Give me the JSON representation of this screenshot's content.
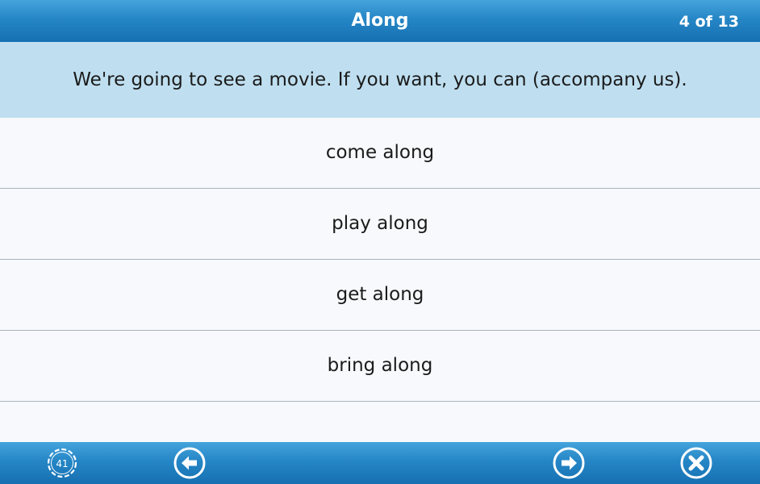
{
  "header": {
    "title": "Along",
    "counter": "4 of 13"
  },
  "question": {
    "text": "We're going to see a movie. If you want, you can (accompany us)."
  },
  "answers": [
    {
      "label": "come along"
    },
    {
      "label": "play along"
    },
    {
      "label": "get along"
    },
    {
      "label": "bring along"
    }
  ],
  "footer": {
    "timer_value": "41",
    "icons": [
      "timer-icon",
      "back-arrow-icon",
      "forward-arrow-icon",
      "close-icon"
    ]
  },
  "colors": {
    "bar_blue": "#2586c6",
    "question_bg": "#bfdff0",
    "answer_bg": "#f7f9fc",
    "divider": "#aab4bd"
  }
}
